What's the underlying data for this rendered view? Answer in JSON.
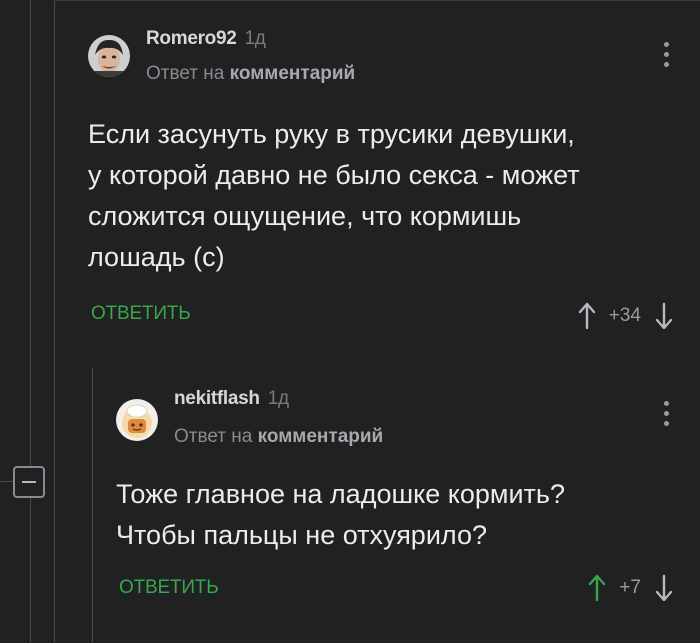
{
  "comments": [
    {
      "author": "Romero92",
      "age": "1д",
      "reply_prefix": "Ответ на",
      "reply_target": "комментарий",
      "text": "Если засунуть руку в трусики девушки,\nу которой давно не было секса - может\nсложится ощущение, что кормишь\nлошадь (с)",
      "reply_label": "ОТВЕТИТЬ",
      "score": "+34",
      "upvoted": false
    },
    {
      "author": "nekitflash",
      "age": "1д",
      "reply_prefix": "Ответ на",
      "reply_target": "комментарий",
      "text": "Тоже главное на ладошке кормить?\nЧтобы пальцы не отхуярило?",
      "reply_label": "ОТВЕТИТЬ",
      "score": "+7",
      "upvoted": true
    }
  ],
  "colors": {
    "accent_green": "#39a64a",
    "background": "#202123",
    "arrow_neutral": "#b8b9bc"
  },
  "icons": [
    "avatar-photo",
    "avatar-chef",
    "more-vertical-icon",
    "arrow-up-icon",
    "arrow-down-icon",
    "collapse-thread-icon"
  ]
}
